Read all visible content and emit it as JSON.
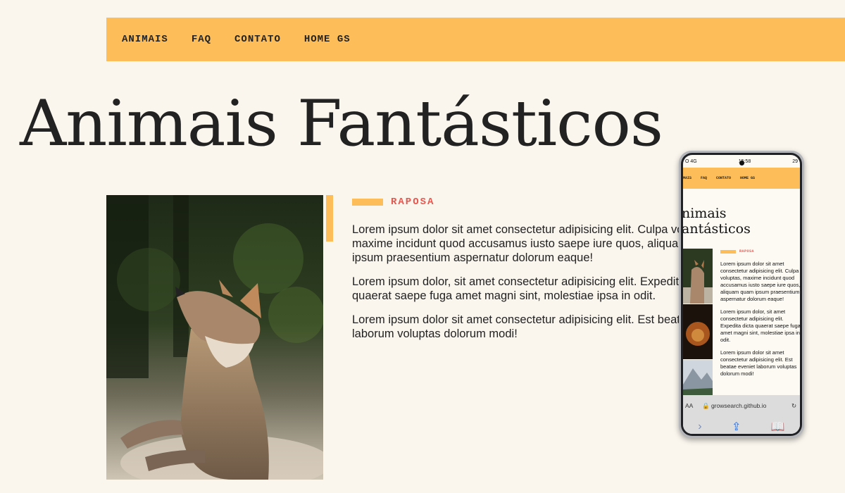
{
  "nav": {
    "links": [
      "ANIMAIS",
      "FAQ",
      "CONTATO",
      "HOME GS"
    ]
  },
  "page": {
    "title": "Animais Fantásticos"
  },
  "section": {
    "title": "RAPOSA",
    "paragraphs": [
      "Lorem ipsum dolor sit amet consectetur adipisicing elit. Culpa voluptas, maxime incidunt quod accusamus iusto saepe iure quos, aliquam quam ipsum praesentium aspernatur dolorum eaque!",
      "Lorem ipsum dolor, sit amet consectetur adipisicing elit. Expedita dicta quaerat saepe fuga amet magni sint, molestiae ipsa in odit.",
      "Lorem ipsum dolor sit amet consectetur adipisicing elit. Est beatae eveniet laborum voluptas dolorum modi!"
    ]
  },
  "phone": {
    "status_left": "O 4G",
    "status_time": "15:58",
    "status_right": "29",
    "nav_links": [
      "MAIS",
      "FAQ",
      "CONTATO",
      "HOME GS"
    ],
    "title_line1": "nimais",
    "title_line2": "antásticos",
    "section_title": "RAPOSA",
    "paragraphs": [
      "Lorem ipsum dolor sit amet consectetur adipisicing elit. Culpa voluptas, maxime incidunt quod accusamus iusto saepe iure quos, aliquam quam ipsum praesentium aspernatur dolorum eaque!",
      "Lorem ipsum dolor, sit amet consectetur adipisicing elit. Expedita dicta quaerat saepe fuga amet magni sint, molestiae ipsa in odit.",
      "Lorem ipsum dolor sit amet consectetur adipisicing elit. Est beatae eveniet laborum voluptas dolorum modi!"
    ],
    "text_size_label": "AA",
    "url": "growsearch.github.io"
  },
  "colors": {
    "background": "#faf6ee",
    "accent": "#fdbd59",
    "section_title": "#e5584f"
  }
}
